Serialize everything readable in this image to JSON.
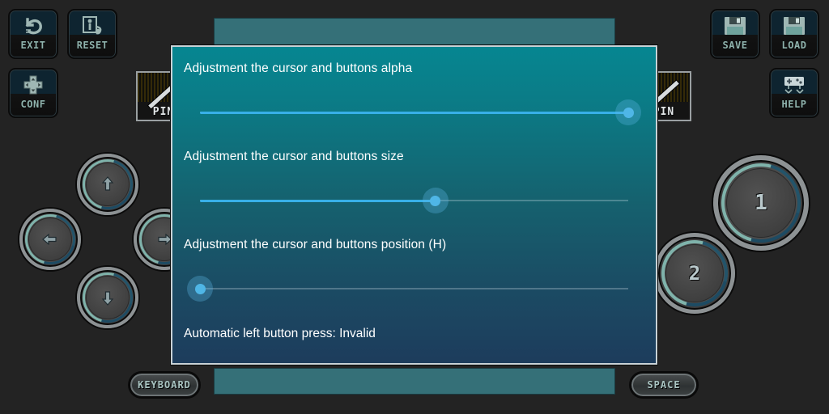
{
  "app": {
    "background_color": "#232323",
    "panel_color": "#357078"
  },
  "toolbar": {
    "left": [
      {
        "label": "EXIT",
        "icon": "undo-arrow-icon",
        "name": "exit-button"
      },
      {
        "label": "RESET",
        "icon": "reset-plug-icon",
        "name": "reset-button"
      },
      {
        "label": "CONF",
        "icon": "dpad-icon",
        "name": "conf-button"
      }
    ],
    "right": [
      {
        "label": "SAVE",
        "icon": "floppy-disk-icon",
        "name": "save-button"
      },
      {
        "label": "LOAD",
        "icon": "floppy-disk-icon",
        "name": "load-button"
      },
      {
        "label": "HELP",
        "icon": "gamepad-icon",
        "name": "help-button"
      }
    ]
  },
  "pin_buttons": [
    {
      "label": "PIN",
      "name": "pin-button-left"
    },
    {
      "label": "PIN",
      "name": "pin-button-right"
    }
  ],
  "dpad": [
    {
      "direction": "up",
      "glyph": "↑",
      "name": "dpad-up-button"
    },
    {
      "direction": "left",
      "glyph": "←",
      "name": "dpad-left-button"
    },
    {
      "direction": "right",
      "glyph": "→",
      "name": "dpad-right-button"
    },
    {
      "direction": "down",
      "glyph": "↓",
      "name": "dpad-down-button"
    }
  ],
  "action_buttons": [
    {
      "label": "1",
      "name": "action-button-1"
    },
    {
      "label": "2",
      "name": "action-button-2"
    }
  ],
  "bottom_bar": {
    "keyboard_label": "KEYBOARD",
    "space_label": "SPACE"
  },
  "dialog": {
    "accent_color": "#38b0e8",
    "thumb_color": "#4fb6e6",
    "border_color": "#c9d2d6",
    "sliders": [
      {
        "label": "Adjustment the cursor and buttons alpha",
        "value": 100,
        "min": 0,
        "max": 100,
        "name": "alpha-slider"
      },
      {
        "label": "Adjustment the cursor and buttons size",
        "value": 55,
        "min": 0,
        "max": 100,
        "name": "size-slider"
      },
      {
        "label": "Adjustment the cursor and buttons position (H)",
        "value": 0,
        "min": 0,
        "max": 100,
        "name": "position-h-slider"
      }
    ],
    "footer": "Automatic left button press: Invalid"
  }
}
